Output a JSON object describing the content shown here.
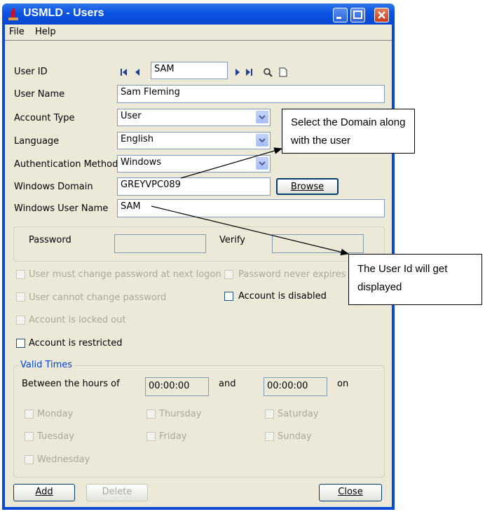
{
  "window": {
    "title": "USMLD - Users"
  },
  "menu": [
    {
      "label": "File"
    },
    {
      "label": "Help"
    }
  ],
  "form": {
    "user_id": {
      "label": "User ID",
      "value": "SAM"
    },
    "user_name": {
      "label": "User Name",
      "value": "Sam Fleming"
    },
    "account_type": {
      "label": "Account Type",
      "value": "User"
    },
    "language": {
      "label": "Language",
      "value": "English"
    },
    "auth_method": {
      "label": "Authentication Method",
      "value": "Windows"
    },
    "windows_domain": {
      "label": "Windows Domain",
      "value": "GREYVPC089"
    },
    "browse_label": "Browse",
    "windows_user": {
      "label": "Windows User Name",
      "value": "SAM"
    },
    "password_label": "Password",
    "verify_label": "Verify"
  },
  "options": {
    "must_change": "User must change password at next logon",
    "never_expires": "Password never expires",
    "cannot_change": "User cannot change password",
    "disabled": "Account is disabled",
    "locked_out": "Account is locked out",
    "restricted": "Account is restricted"
  },
  "valid_times": {
    "title": "Valid Times",
    "between": "Between the hours of",
    "from": "00:00:00",
    "and": "and",
    "to": "00:00:00",
    "on": "on",
    "days": [
      "Monday",
      "Thursday",
      "Saturday",
      "Tuesday",
      "Friday",
      "Sunday",
      "Wednesday"
    ]
  },
  "buttons": {
    "add": "Add",
    "delete": "Delete",
    "close": "Close"
  },
  "callouts": {
    "domain": "Select the Domain along with the user",
    "userid": "The User Id will get displayed"
  }
}
